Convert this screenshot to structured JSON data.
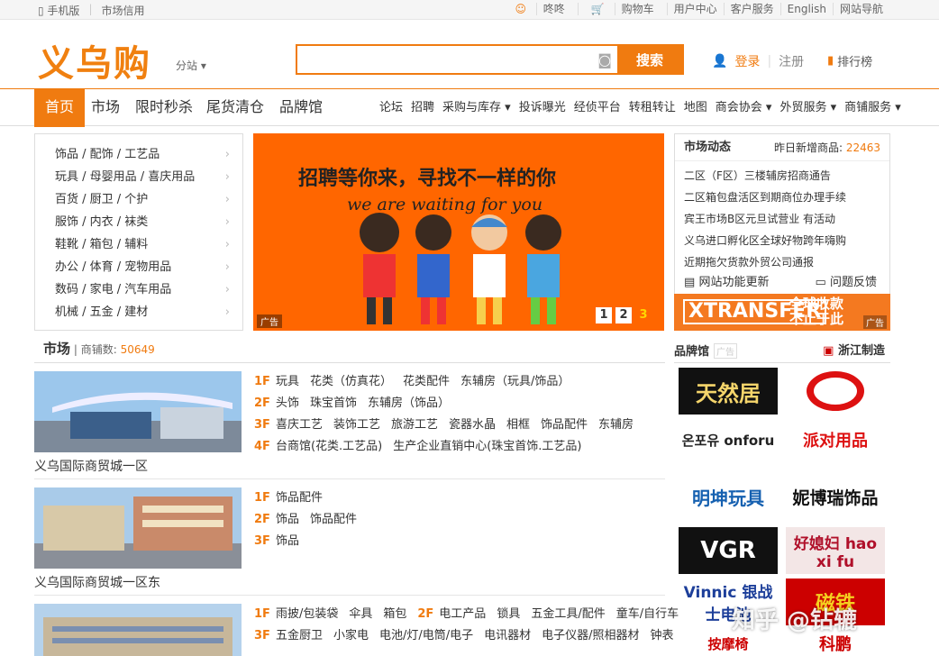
{
  "topbar": {
    "mobile": "手机版",
    "credit": "市场信用",
    "dongdong": "咚咚",
    "cart": "购物车",
    "user": "用户中心",
    "service": "客户服务",
    "english": "English",
    "sitenav": "网站导航"
  },
  "header": {
    "logo": "义乌购",
    "substation": "分站 ▾",
    "search_placeholder": "",
    "search_btn": "搜索",
    "login": "登录",
    "register": "注册",
    "rank": "排行榜"
  },
  "nav": {
    "main": [
      "首页",
      "市场",
      "限时秒杀",
      "尾货清仓",
      "品牌馆"
    ],
    "sub": [
      "论坛",
      "招聘",
      "采购与库存 ▾",
      "投诉曝光",
      "经侦平台",
      "转租转让",
      "地图",
      "商会协会 ▾",
      "外贸服务 ▾",
      "商铺服务 ▾"
    ]
  },
  "categories": [
    "饰品 / 配饰 / 工艺品",
    "玩具 / 母婴用品 / 喜庆用品",
    "百货 / 厨卫 / 个护",
    "服饰 / 内衣 / 袜类",
    "鞋靴 / 箱包 / 辅料",
    "办公 / 体育 / 宠物用品",
    "数码 / 家电 / 汽车用品",
    "机械 / 五金 / 建材"
  ],
  "banner": {
    "title": "招聘等你来，寻找不一样的你",
    "subtitle": "we are waiting for you",
    "ad": "广告",
    "pages": [
      "1",
      "2",
      "3"
    ]
  },
  "news": {
    "title": "市场动态",
    "newcount_label": "昨日新增商品:",
    "newcount": "22463",
    "items": [
      "二区（F区）三楼辅房招商通告",
      "二区箱包盘活区到期商位办理手续",
      "宾王市场B区元旦试营业 有活动",
      "义乌进口孵化区全球好物跨年嗨购",
      "近期拖欠货款外贸公司通报"
    ],
    "update": "网站功能更新",
    "feedback": "问题反馈"
  },
  "xtransfer": {
    "logo": "XTRANSFER",
    "line1": "全球收款",
    "line2": "不止于此",
    "ad": "广告"
  },
  "market": {
    "title": "市场",
    "count_label": "商铺数:",
    "count": "50649",
    "items": [
      {
        "name": "义乌国际商贸城一区",
        "floors": [
          {
            "f": "1F",
            "items": [
              "玩具",
              "花类（仿真花）",
              "花类配件",
              "东辅房（玩具/饰品）"
            ]
          },
          {
            "f": "2F",
            "items": [
              "头饰",
              "珠宝首饰",
              "东辅房（饰品）"
            ]
          },
          {
            "f": "3F",
            "items": [
              "喜庆工艺",
              "装饰工艺",
              "旅游工艺",
              "瓷器水晶",
              "相框",
              "饰品配件",
              "东辅房"
            ]
          },
          {
            "f": "4F",
            "items": [
              "台商馆(花类.工艺品)",
              "生产企业直销中心(珠宝首饰.工艺品)"
            ]
          }
        ]
      },
      {
        "name": "义乌国际商贸城一区东",
        "floors": [
          {
            "f": "1F",
            "items": [
              "饰品配件"
            ]
          },
          {
            "f": "2F",
            "items": [
              "饰品",
              "饰品配件"
            ]
          },
          {
            "f": "3F",
            "items": [
              "饰品"
            ]
          }
        ]
      },
      {
        "name": "",
        "floors": [
          {
            "f": "1F",
            "items": [
              "雨披/包装袋",
              "伞具",
              "箱包"
            ],
            "f2": "2F",
            "items2": [
              "电工产品",
              "锁具",
              "五金工具/配件",
              "童车/自行车"
            ]
          },
          {
            "f": "3F",
            "items": [
              "五金厨卫",
              "小家电",
              "电池/灯/电筒/电子",
              "电讯器材",
              "电子仪器/照相器材",
              "钟表"
            ]
          }
        ]
      }
    ]
  },
  "brands": {
    "title": "品牌馆",
    "ad": "广告",
    "region": "浙江制造",
    "items": [
      "天然居",
      "",
      "온포유 onforu",
      "派对用品",
      "明坤玩具",
      "妮博瑞饰品",
      "VGR",
      "好媳妇 hao xi fu",
      "Vinnic 银战士电池",
      "磁铁",
      "按摩椅",
      "科鹏"
    ]
  },
  "watermark": "知乎 @钻辘"
}
